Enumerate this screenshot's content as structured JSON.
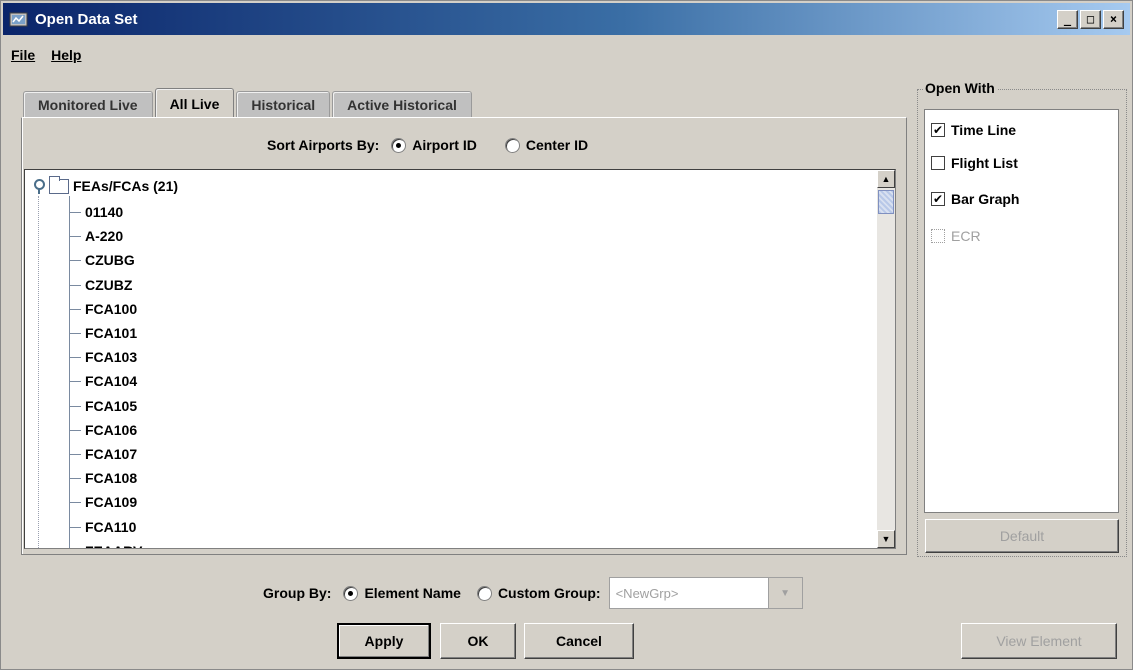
{
  "window": {
    "title": "Open Data Set",
    "buttons": [
      "_",
      "□",
      "×"
    ]
  },
  "menu": [
    {
      "label": "File"
    },
    {
      "label": "Help"
    }
  ],
  "tabs": [
    {
      "label": "Monitored Live",
      "active": false
    },
    {
      "label": "All Live",
      "active": true
    },
    {
      "label": "Historical",
      "active": false
    },
    {
      "label": "Active Historical",
      "active": false
    }
  ],
  "sort": {
    "label": "Sort Airports By:",
    "options": [
      {
        "label": "Airport ID",
        "selected": true
      },
      {
        "label": "Center ID",
        "selected": false
      }
    ]
  },
  "tree": {
    "root_label": "FEAs/FCAs (21)",
    "items": [
      "01140",
      "A-220",
      "CZUBG",
      "CZUBZ",
      "FCA100",
      "FCA101",
      "FCA103",
      "FCA104",
      "FCA105",
      "FCA106",
      "FCA107",
      "FCA108",
      "FCA109",
      "FCA110",
      "FEAARV"
    ]
  },
  "group": {
    "label": "Group By:",
    "options": [
      {
        "label": "Element Name",
        "selected": true
      },
      {
        "label": "Custom Group:",
        "selected": false
      }
    ],
    "combo_placeholder": "<NewGrp>"
  },
  "buttons": {
    "apply": "Apply",
    "ok": "OK",
    "cancel": "Cancel",
    "view_element": "View Element"
  },
  "open_with": {
    "title": "Open With",
    "options": [
      {
        "label": "Time Line",
        "checked": true,
        "enabled": true
      },
      {
        "label": "Flight List",
        "checked": false,
        "enabled": true
      },
      {
        "label": "Bar Graph",
        "checked": true,
        "enabled": true
      },
      {
        "label": "ECR",
        "checked": false,
        "enabled": false
      }
    ],
    "default_button": "Default"
  }
}
